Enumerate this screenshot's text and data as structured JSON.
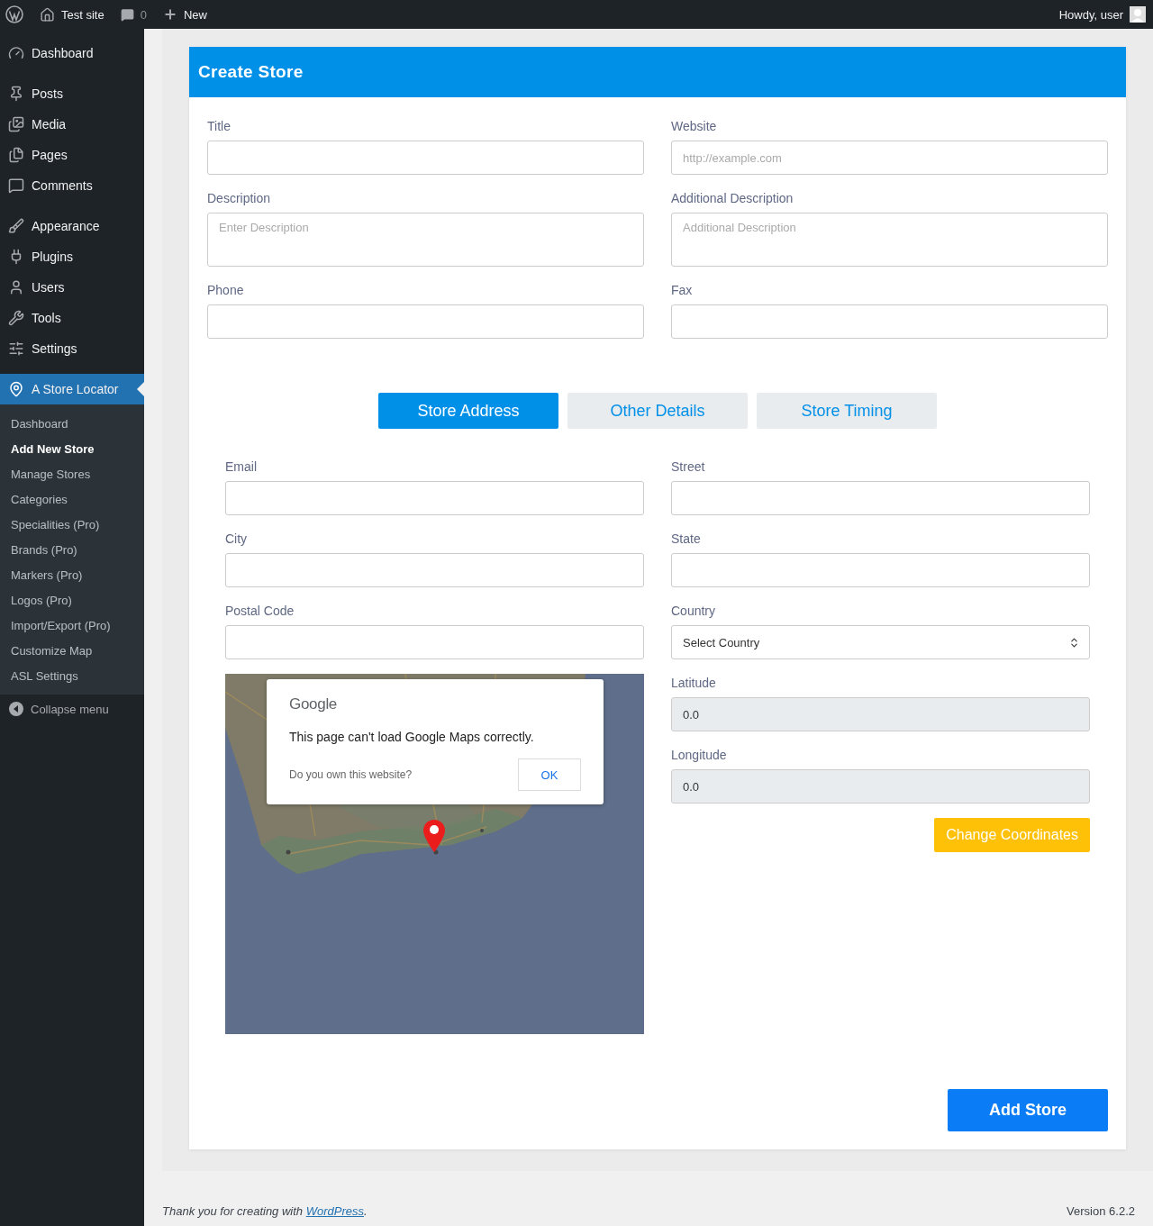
{
  "top_bar": {
    "site": "Test site",
    "comments": "0",
    "new": "New",
    "greeting": "Howdy, user"
  },
  "sidebar": {
    "groups": [
      {
        "items": [
          {
            "label": "Dashboard",
            "selected": false
          }
        ]
      },
      {
        "items": [
          {
            "label": "Posts",
            "selected": false
          },
          {
            "label": "Media",
            "selected": false
          },
          {
            "label": "Pages",
            "selected": false
          },
          {
            "label": "Comments",
            "selected": false
          }
        ]
      },
      {
        "items": [
          {
            "label": "Appearance",
            "selected": false
          },
          {
            "label": "Plugins",
            "selected": false
          },
          {
            "label": "Users",
            "selected": false
          },
          {
            "label": "Tools",
            "selected": false
          },
          {
            "label": "Settings",
            "selected": false
          }
        ]
      },
      {
        "items": [
          {
            "label": "A Store Locator",
            "selected": true
          }
        ]
      }
    ],
    "submenu": [
      {
        "label": "Dashboard",
        "selected": false
      },
      {
        "label": "Add New Store",
        "selected": true
      },
      {
        "label": "Manage Stores",
        "selected": false
      },
      {
        "label": "Categories",
        "selected": false
      },
      {
        "label": "Specialities (Pro)",
        "selected": false
      },
      {
        "label": "Brands (Pro)",
        "selected": false
      },
      {
        "label": "Markers (Pro)",
        "selected": false
      },
      {
        "label": "Logos (Pro)",
        "selected": false
      },
      {
        "label": "Import/Export (Pro)",
        "selected": false
      },
      {
        "label": "Customize Map",
        "selected": false
      },
      {
        "label": "ASL Settings",
        "selected": false
      }
    ],
    "collapse": "Collapse menu"
  },
  "card": {
    "title": "Create Store",
    "fields": [
      {
        "label": "Title",
        "kind": "input"
      },
      {
        "label": "Website",
        "kind": "input",
        "placeholder": "http://example.com"
      },
      {
        "label": "Description",
        "kind": "textarea",
        "placeholder": "Enter Description"
      },
      {
        "label": "Additional Description",
        "kind": "textarea",
        "placeholder": "Additional Description"
      },
      {
        "label": "Phone",
        "kind": "input"
      },
      {
        "label": "Fax",
        "kind": "input"
      }
    ],
    "tabs": [
      {
        "label": "Store Address",
        "selected": true
      },
      {
        "label": "Other Details",
        "selected": false
      },
      {
        "label": "Store Timing",
        "selected": false
      }
    ],
    "address_left": [
      {
        "label": "Email",
        "kind": "input"
      },
      {
        "label": "City",
        "kind": "input"
      },
      {
        "label": "Postal Code",
        "kind": "input"
      }
    ],
    "address_right": [
      {
        "label": "Street",
        "kind": "input"
      },
      {
        "label": "State",
        "kind": "input"
      },
      {
        "label": "Country",
        "kind": "select",
        "value": "Select Country"
      },
      {
        "label": "Latitude",
        "kind": "readonly",
        "value": "0.0"
      },
      {
        "label": "Longitude",
        "kind": "readonly",
        "value": "0.0"
      }
    ],
    "map": {
      "kind": "picture",
      "dialog": {
        "brand": "Google",
        "message": "This page can't load Google Maps correctly.",
        "question": "Do you own this website?",
        "button": "OK"
      }
    },
    "change_button": "Change Coordinates",
    "submit_button": "Add Store"
  },
  "footer": {
    "text_before": "Thank you for creating with ",
    "link": "WordPress",
    "text_after": ".",
    "version": "Version 6.2.2"
  }
}
